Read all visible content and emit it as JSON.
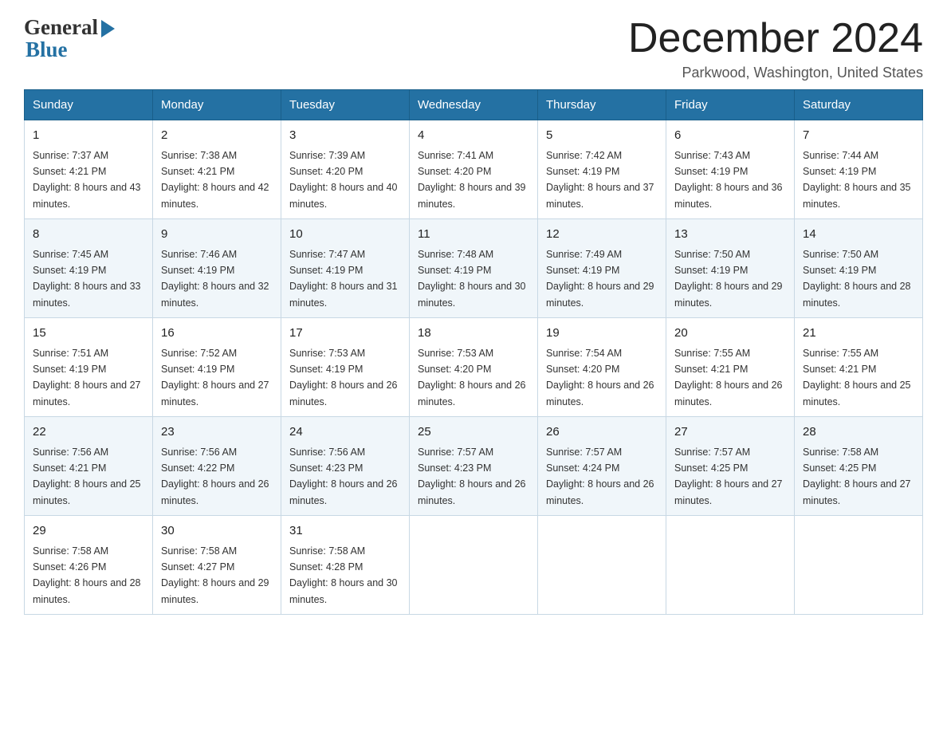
{
  "header": {
    "title": "December 2024",
    "location": "Parkwood, Washington, United States",
    "logo_general": "General",
    "logo_blue": "Blue"
  },
  "days_of_week": [
    "Sunday",
    "Monday",
    "Tuesday",
    "Wednesday",
    "Thursday",
    "Friday",
    "Saturday"
  ],
  "weeks": [
    [
      {
        "day": "1",
        "sunrise": "7:37 AM",
        "sunset": "4:21 PM",
        "daylight": "8 hours and 43 minutes."
      },
      {
        "day": "2",
        "sunrise": "7:38 AM",
        "sunset": "4:21 PM",
        "daylight": "8 hours and 42 minutes."
      },
      {
        "day": "3",
        "sunrise": "7:39 AM",
        "sunset": "4:20 PM",
        "daylight": "8 hours and 40 minutes."
      },
      {
        "day": "4",
        "sunrise": "7:41 AM",
        "sunset": "4:20 PM",
        "daylight": "8 hours and 39 minutes."
      },
      {
        "day": "5",
        "sunrise": "7:42 AM",
        "sunset": "4:19 PM",
        "daylight": "8 hours and 37 minutes."
      },
      {
        "day": "6",
        "sunrise": "7:43 AM",
        "sunset": "4:19 PM",
        "daylight": "8 hours and 36 minutes."
      },
      {
        "day": "7",
        "sunrise": "7:44 AM",
        "sunset": "4:19 PM",
        "daylight": "8 hours and 35 minutes."
      }
    ],
    [
      {
        "day": "8",
        "sunrise": "7:45 AM",
        "sunset": "4:19 PM",
        "daylight": "8 hours and 33 minutes."
      },
      {
        "day": "9",
        "sunrise": "7:46 AM",
        "sunset": "4:19 PM",
        "daylight": "8 hours and 32 minutes."
      },
      {
        "day": "10",
        "sunrise": "7:47 AM",
        "sunset": "4:19 PM",
        "daylight": "8 hours and 31 minutes."
      },
      {
        "day": "11",
        "sunrise": "7:48 AM",
        "sunset": "4:19 PM",
        "daylight": "8 hours and 30 minutes."
      },
      {
        "day": "12",
        "sunrise": "7:49 AM",
        "sunset": "4:19 PM",
        "daylight": "8 hours and 29 minutes."
      },
      {
        "day": "13",
        "sunrise": "7:50 AM",
        "sunset": "4:19 PM",
        "daylight": "8 hours and 29 minutes."
      },
      {
        "day": "14",
        "sunrise": "7:50 AM",
        "sunset": "4:19 PM",
        "daylight": "8 hours and 28 minutes."
      }
    ],
    [
      {
        "day": "15",
        "sunrise": "7:51 AM",
        "sunset": "4:19 PM",
        "daylight": "8 hours and 27 minutes."
      },
      {
        "day": "16",
        "sunrise": "7:52 AM",
        "sunset": "4:19 PM",
        "daylight": "8 hours and 27 minutes."
      },
      {
        "day": "17",
        "sunrise": "7:53 AM",
        "sunset": "4:19 PM",
        "daylight": "8 hours and 26 minutes."
      },
      {
        "day": "18",
        "sunrise": "7:53 AM",
        "sunset": "4:20 PM",
        "daylight": "8 hours and 26 minutes."
      },
      {
        "day": "19",
        "sunrise": "7:54 AM",
        "sunset": "4:20 PM",
        "daylight": "8 hours and 26 minutes."
      },
      {
        "day": "20",
        "sunrise": "7:55 AM",
        "sunset": "4:21 PM",
        "daylight": "8 hours and 26 minutes."
      },
      {
        "day": "21",
        "sunrise": "7:55 AM",
        "sunset": "4:21 PM",
        "daylight": "8 hours and 25 minutes."
      }
    ],
    [
      {
        "day": "22",
        "sunrise": "7:56 AM",
        "sunset": "4:21 PM",
        "daylight": "8 hours and 25 minutes."
      },
      {
        "day": "23",
        "sunrise": "7:56 AM",
        "sunset": "4:22 PM",
        "daylight": "8 hours and 26 minutes."
      },
      {
        "day": "24",
        "sunrise": "7:56 AM",
        "sunset": "4:23 PM",
        "daylight": "8 hours and 26 minutes."
      },
      {
        "day": "25",
        "sunrise": "7:57 AM",
        "sunset": "4:23 PM",
        "daylight": "8 hours and 26 minutes."
      },
      {
        "day": "26",
        "sunrise": "7:57 AM",
        "sunset": "4:24 PM",
        "daylight": "8 hours and 26 minutes."
      },
      {
        "day": "27",
        "sunrise": "7:57 AM",
        "sunset": "4:25 PM",
        "daylight": "8 hours and 27 minutes."
      },
      {
        "day": "28",
        "sunrise": "7:58 AM",
        "sunset": "4:25 PM",
        "daylight": "8 hours and 27 minutes."
      }
    ],
    [
      {
        "day": "29",
        "sunrise": "7:58 AM",
        "sunset": "4:26 PM",
        "daylight": "8 hours and 28 minutes."
      },
      {
        "day": "30",
        "sunrise": "7:58 AM",
        "sunset": "4:27 PM",
        "daylight": "8 hours and 29 minutes."
      },
      {
        "day": "31",
        "sunrise": "7:58 AM",
        "sunset": "4:28 PM",
        "daylight": "8 hours and 30 minutes."
      },
      null,
      null,
      null,
      null
    ]
  ]
}
